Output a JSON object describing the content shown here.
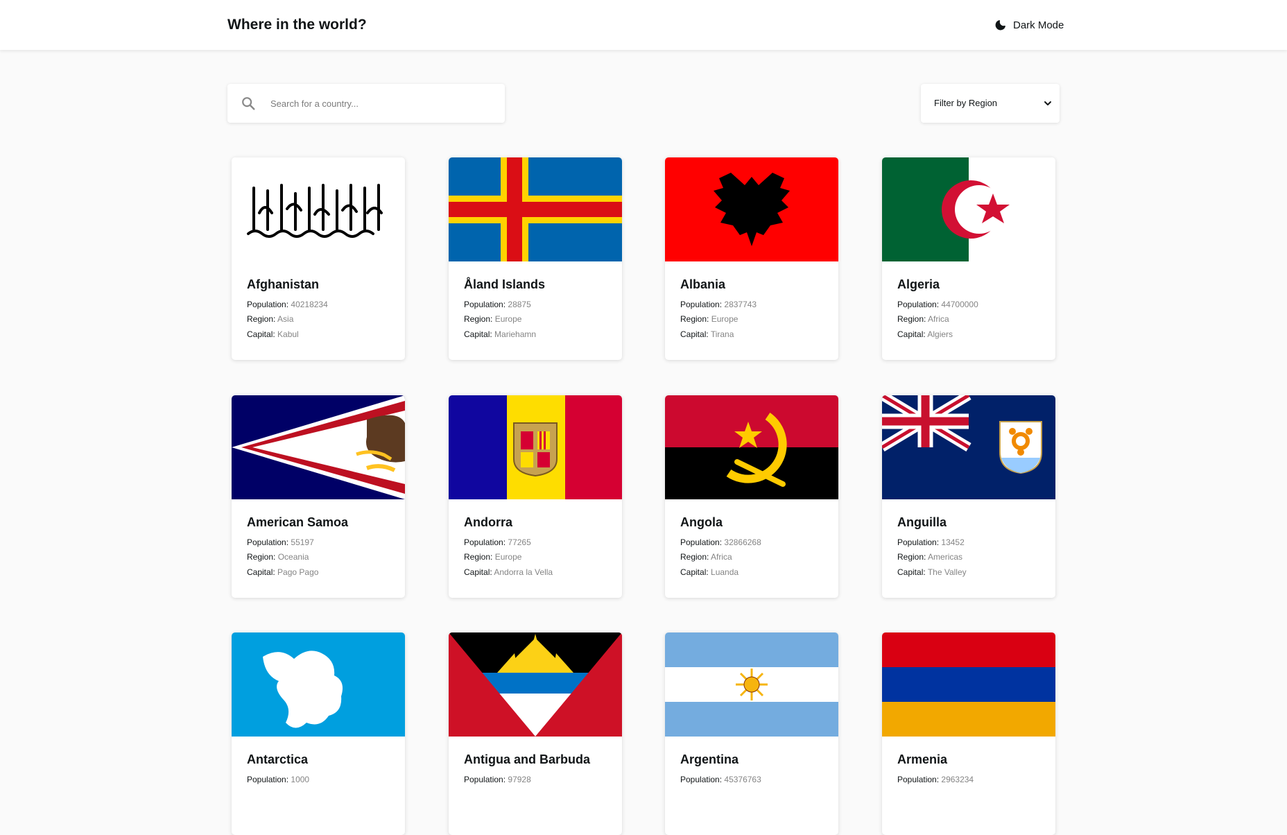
{
  "header": {
    "title": "Where in the world?",
    "dark_mode_label": "Dark Mode"
  },
  "search": {
    "placeholder": "Search for a country..."
  },
  "filter": {
    "label": "Filter by Region"
  },
  "labels": {
    "population": "Population:",
    "region": "Region:",
    "capital": "Capital:"
  },
  "countries": [
    {
      "name": "Afghanistan",
      "population": "40218234",
      "region": "Asia",
      "capital": "Kabul"
    },
    {
      "name": "Åland Islands",
      "population": "28875",
      "region": "Europe",
      "capital": "Mariehamn"
    },
    {
      "name": "Albania",
      "population": "2837743",
      "region": "Europe",
      "capital": "Tirana"
    },
    {
      "name": "Algeria",
      "population": "44700000",
      "region": "Africa",
      "capital": "Algiers"
    },
    {
      "name": "American Samoa",
      "population": "55197",
      "region": "Oceania",
      "capital": "Pago Pago"
    },
    {
      "name": "Andorra",
      "population": "77265",
      "region": "Europe",
      "capital": "Andorra la Vella"
    },
    {
      "name": "Angola",
      "population": "32866268",
      "region": "Africa",
      "capital": "Luanda"
    },
    {
      "name": "Anguilla",
      "population": "13452",
      "region": "Americas",
      "capital": "The Valley"
    },
    {
      "name": "Antarctica",
      "population": "1000"
    },
    {
      "name": "Antigua and Barbuda",
      "population": "97928"
    },
    {
      "name": "Argentina",
      "population": "45376763"
    },
    {
      "name": "Armenia",
      "population": "2963234"
    }
  ],
  "colors": {
    "background": "#fafafa",
    "surface": "#ffffff",
    "text": "#111517",
    "muted_text": "#848484"
  },
  "icons": {
    "dark_mode": "moon-icon",
    "search": "search-icon",
    "filter": "chevron-down-icon"
  }
}
